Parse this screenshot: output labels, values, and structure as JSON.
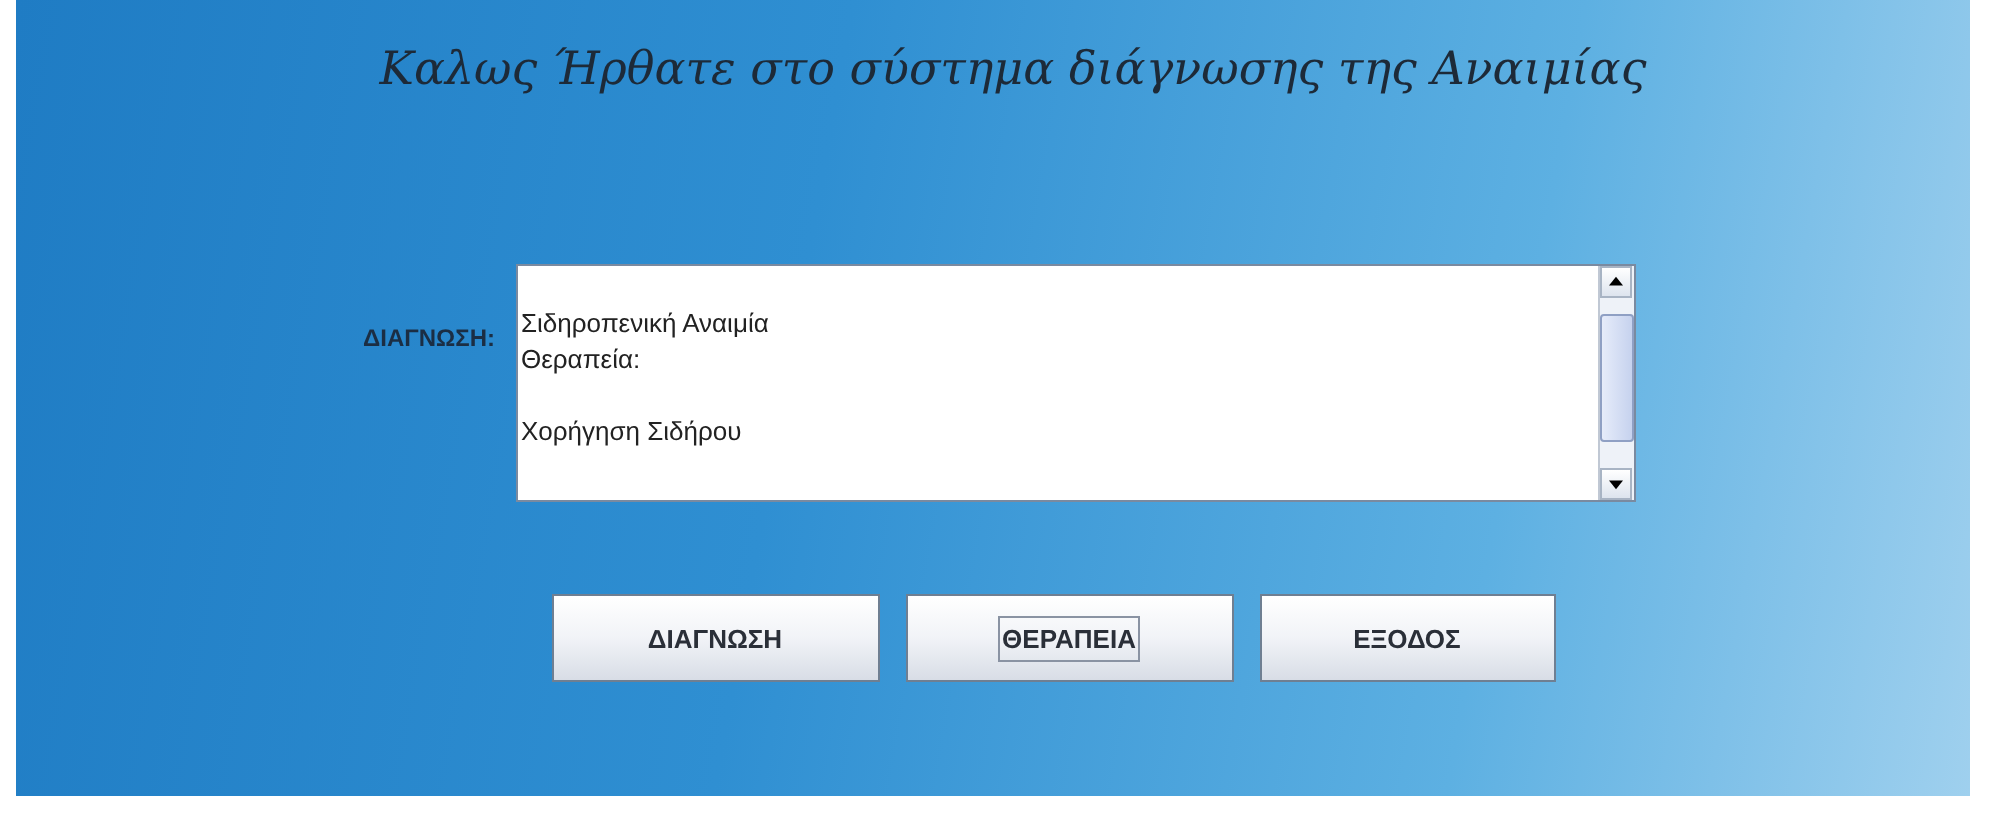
{
  "title": "Καλως Ήρθατε στο σύστημα διάγνωσης της Αναιμίας",
  "diagnosis": {
    "label": "ΔΙΑΓΝΩΣΗ:",
    "lines": [
      {
        "text": "Σιδηροπενική Αναιμία",
        "blank_line_before": true
      },
      {
        "text": "Θεραπεία:",
        "blank_line_before": false
      },
      {
        "text": "Χορήγηση Σιδήρου",
        "blank_line_before": true
      }
    ]
  },
  "buttons": [
    {
      "label": "ΔΙΑΓΝΩΣΗ",
      "focused": false
    },
    {
      "label": "ΘΕΡΑΠΕΙΑ",
      "focused": true
    },
    {
      "label": "ΕΞΟΔΟΣ",
      "focused": false
    }
  ]
}
